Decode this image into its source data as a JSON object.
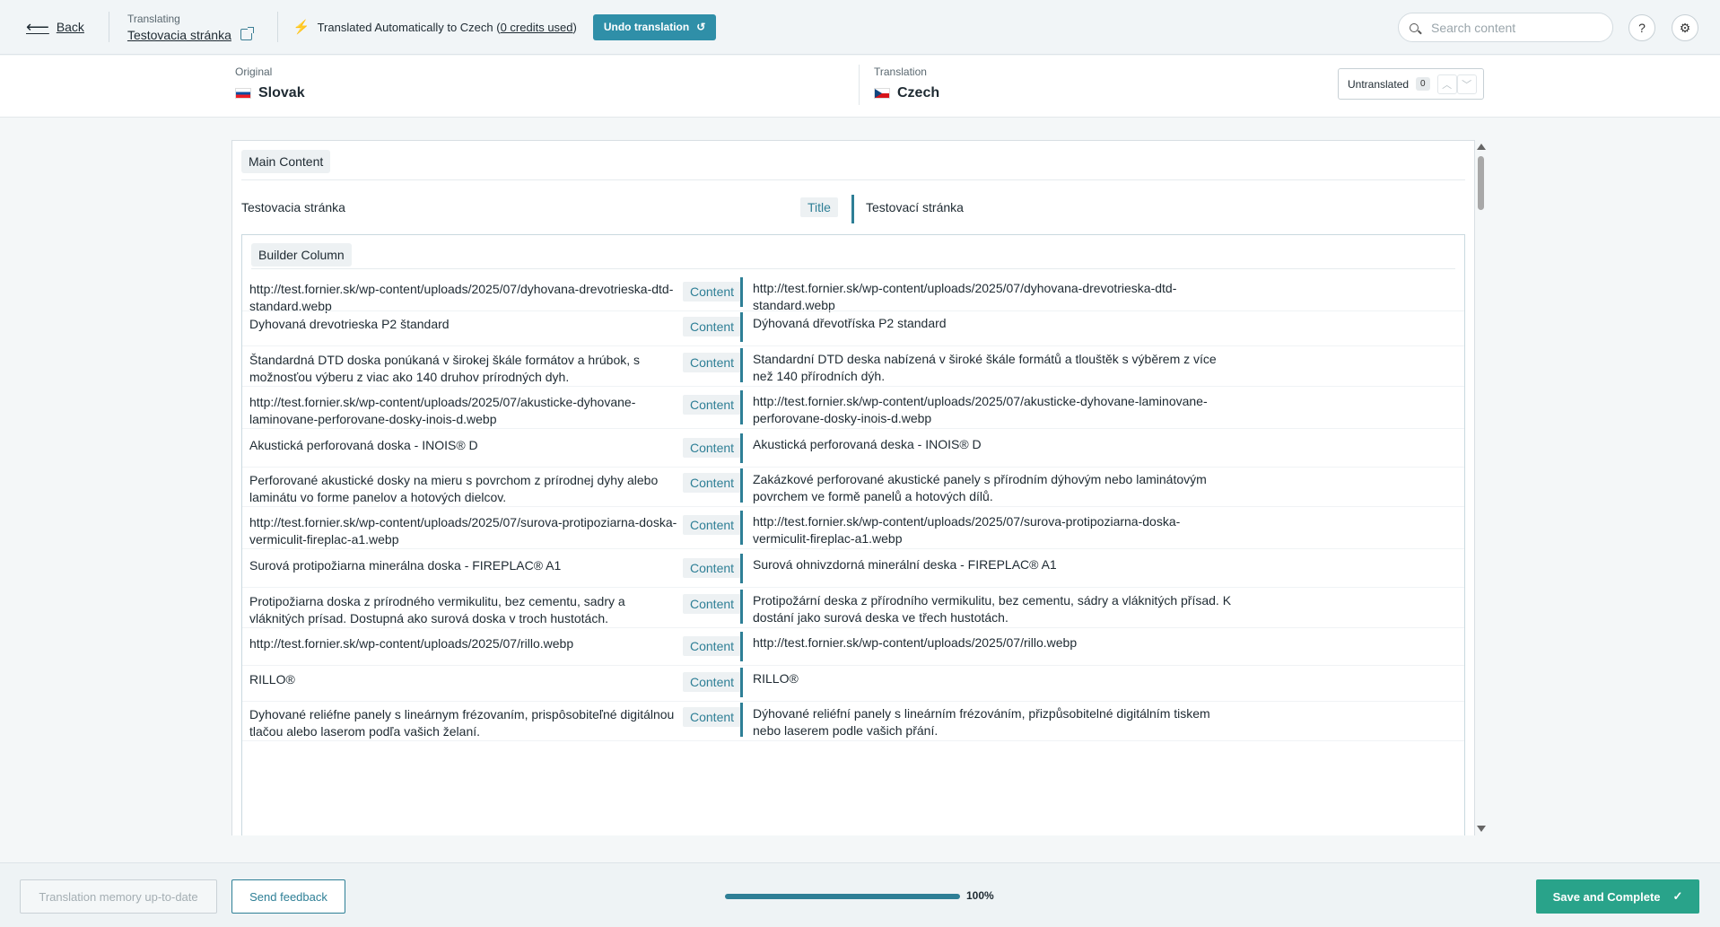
{
  "topbar": {
    "back_label": "Back",
    "translating_label": "Translating",
    "page_name": "Testovacia stránka",
    "auto_text": "Translated Automatically to Czech (",
    "credits": "0 credits used",
    "auto_close": ")",
    "undo_label": "Undo translation",
    "search_placeholder": "Search content"
  },
  "languages": {
    "original_label": "Original",
    "original_value": "Slovak",
    "translation_label": "Translation",
    "translation_value": "Czech",
    "untranslated_label": "Untranslated",
    "untranslated_count": "0"
  },
  "main": {
    "section_label": "Main Content",
    "title_row": {
      "source": "Testovacia stránka",
      "type": "Title",
      "target": "Testovací stránka"
    },
    "builder_label": "Builder Column",
    "rows": [
      {
        "source": "http://test.fornier.sk/wp-content/uploads/2025/07/dyhovana-drevotrieska-dtd-standard.webp",
        "type": "Content",
        "target": "http://test.fornier.sk/wp-content/uploads/2025/07/dyhovana-drevotrieska-dtd-standard.webp"
      },
      {
        "source": "Dyhovaná drevotrieska P2 štandard",
        "type": "Content",
        "target": "Dýhovaná dřevotříska P2 standard"
      },
      {
        "source": "Štandardná DTD doska ponúkaná v širokej škále formátov a hrúbok, s možnosťou výberu z viac ako 140 druhov prírodných dyh.",
        "type": "Content",
        "target": "Standardní DTD deska nabízená v široké škále formátů a tlouštěk s výběrem z více než 140 přírodních dýh."
      },
      {
        "source": "http://test.fornier.sk/wp-content/uploads/2025/07/akusticke-dyhovane-laminovane-perforovane-dosky-inois-d.webp",
        "type": "Content",
        "target": "http://test.fornier.sk/wp-content/uploads/2025/07/akusticke-dyhovane-laminovane-perforovane-dosky-inois-d.webp"
      },
      {
        "source": "Akustická perforovaná doska - INOIS® D",
        "type": "Content",
        "target": "Akustická perforovaná deska - INOIS® D"
      },
      {
        "source": "Perforované akustické dosky na mieru s povrchom z prírodnej dyhy alebo laminátu vo forme panelov a hotových dielcov.",
        "type": "Content",
        "target": "Zakázkové perforované akustické panely s přírodním dýhovým nebo laminátovým povrchem ve formě panelů a hotových dílů."
      },
      {
        "source": "http://test.fornier.sk/wp-content/uploads/2025/07/surova-protipoziarna-doska-vermiculit-fireplac-a1.webp",
        "type": "Content",
        "target": "http://test.fornier.sk/wp-content/uploads/2025/07/surova-protipoziarna-doska-vermiculit-fireplac-a1.webp"
      },
      {
        "source": "Surová protipožiarna minerálna doska - FIREPLAC® A1",
        "type": "Content",
        "target": "Surová ohnivzdorná minerální deska - FIREPLAC® A1"
      },
      {
        "source": "Protipožiarna doska z prírodného vermikulitu, bez cementu, sadry a vláknitých prísad. Dostupná ako surová doska v troch hustotách.",
        "type": "Content",
        "target": "Protipožární deska z přírodního vermikulitu, bez cementu, sádry a vláknitých přísad. K dostání jako surová deska ve třech hustotách."
      },
      {
        "source": "http://test.fornier.sk/wp-content/uploads/2025/07/rillo.webp",
        "type": "Content",
        "target": "http://test.fornier.sk/wp-content/uploads/2025/07/rillo.webp"
      },
      {
        "source": "RILLO®",
        "type": "Content",
        "target": "RILLO®"
      },
      {
        "source": "Dyhované reliéfne panely s lineárnym frézovaním, prispôsobiteľné digitálnou tlačou alebo laserom podľa vašich želaní.",
        "type": "Content",
        "target": "Dýhované reliéfní panely s lineárním frézováním, přizpůsobitelné digitálním tiskem nebo laserem podle vašich přání."
      }
    ]
  },
  "footer": {
    "memory_label": "Translation memory up-to-date",
    "feedback_label": "Send feedback",
    "progress_percent": 100,
    "progress_label": "100%",
    "save_label": "Save and Complete"
  },
  "colors": {
    "accent": "#2e7f96",
    "primary": "#29a38a"
  },
  "icons": [
    "arrow-left-icon",
    "external-link-icon",
    "lightning-icon",
    "undo-icon",
    "search-icon",
    "help-icon",
    "gear-icon",
    "chevron-up-icon",
    "chevron-down-icon",
    "check-icon"
  ]
}
